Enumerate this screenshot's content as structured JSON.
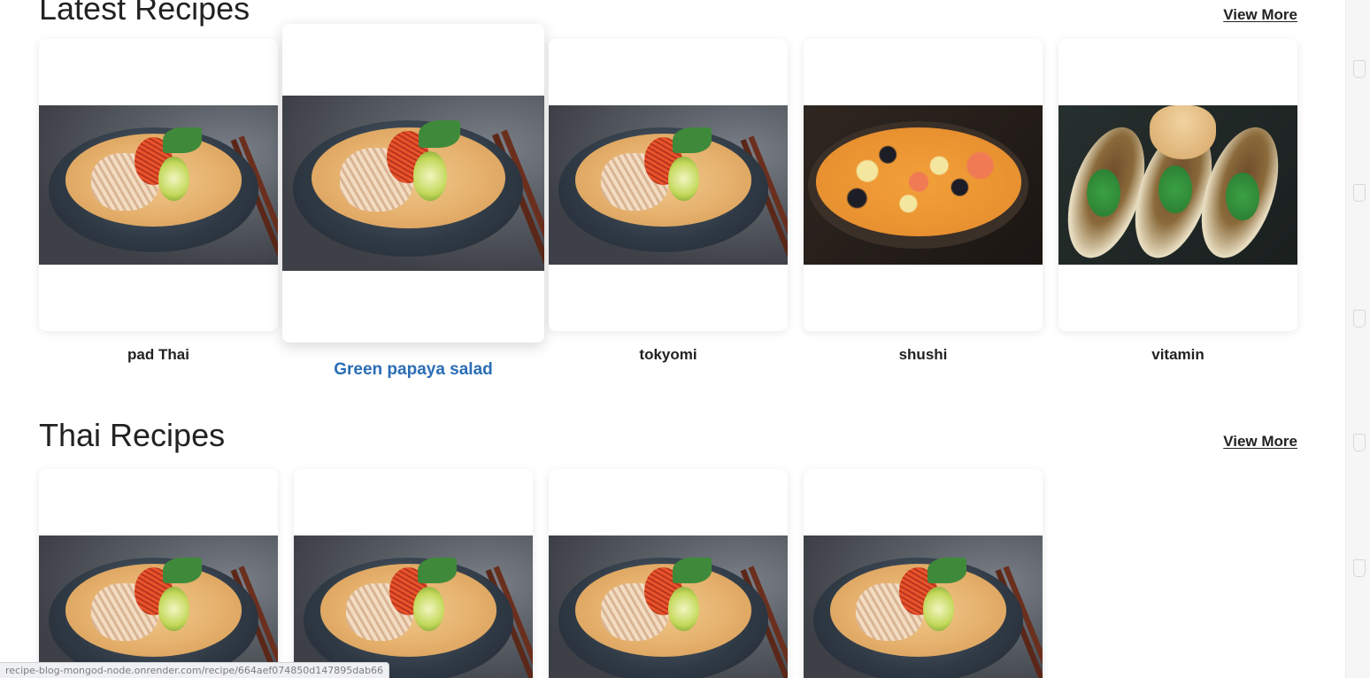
{
  "latest": {
    "title": "Latest Recipes",
    "view_more": "View More",
    "cards": [
      {
        "label": "pad Thai",
        "image": "noodle-soup-bowl"
      },
      {
        "label": "Green papaya salad",
        "image": "noodle-soup-bowl",
        "state": "hover"
      },
      {
        "label": "tokyomi",
        "image": "noodle-soup-bowl"
      },
      {
        "label": "shushi",
        "image": "paella-pan"
      },
      {
        "label": "vitamin",
        "image": "tacos-plate"
      }
    ]
  },
  "thai": {
    "title": "Thai Recipes",
    "view_more": "View More",
    "cards": [
      {
        "image": "noodle-soup-bowl"
      },
      {
        "image": "noodle-soup-bowl"
      },
      {
        "image": "noodle-soup-bowl"
      },
      {
        "image": "noodle-soup-bowl"
      }
    ]
  },
  "status_bar": {
    "url": "recipe-blog-mongod-node.onrender.com/recipe/664aef074850d147895dab66"
  },
  "colors": {
    "heading": "#222222",
    "link_hover": "#2a6db5",
    "card_bg": "#ffffff"
  }
}
